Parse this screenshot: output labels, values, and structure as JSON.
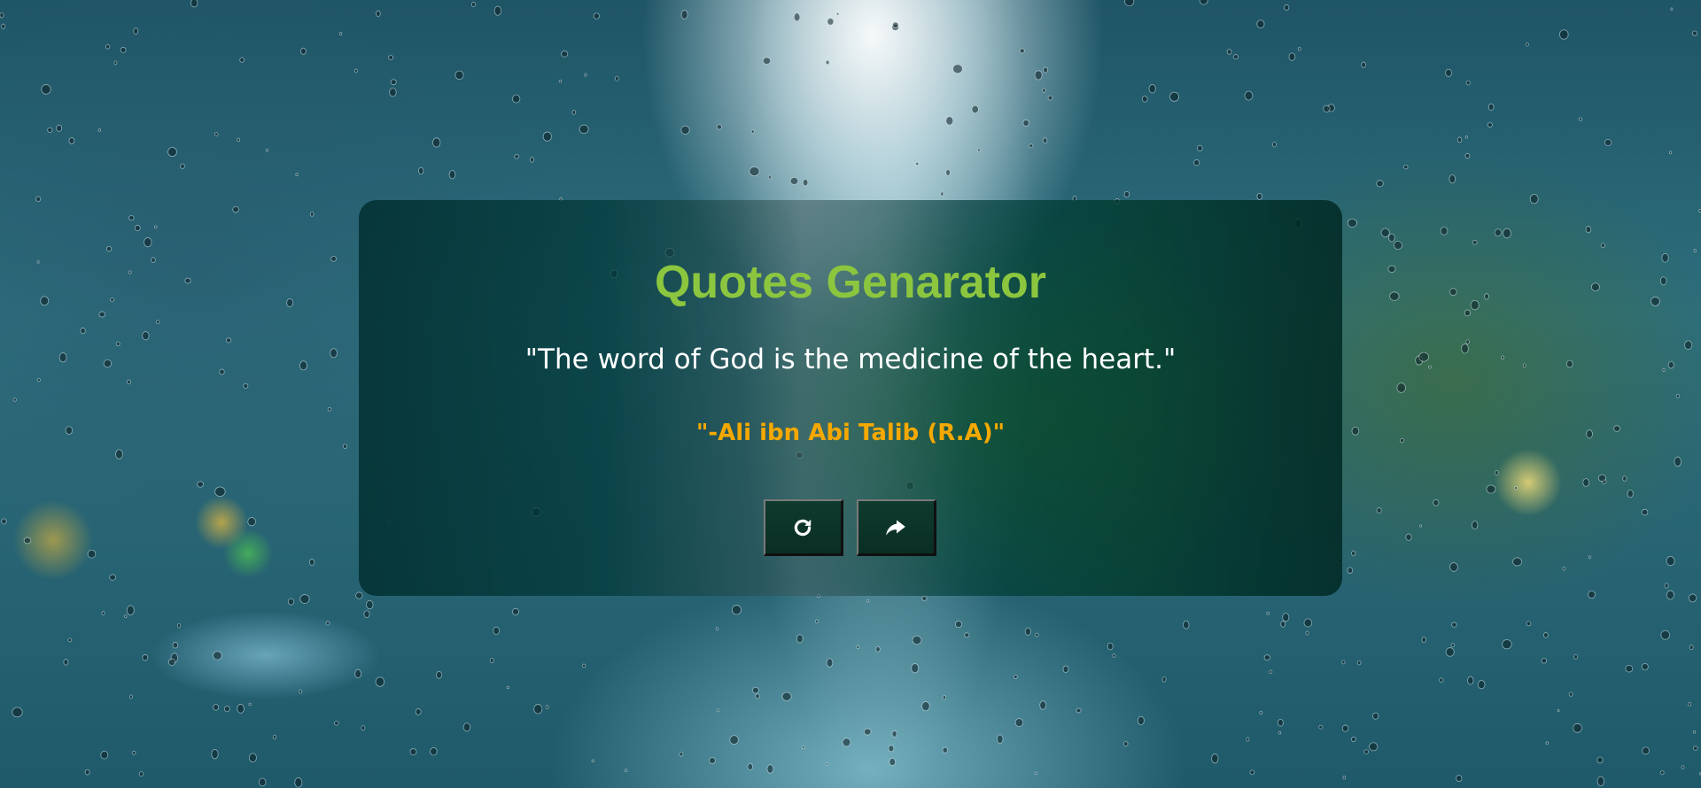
{
  "app": {
    "title": "Quotes Genarator"
  },
  "quote": {
    "text": "\"The word of God is the medicine of the heart.\"",
    "author": "\"-Ali ibn Abi Talib (R.A)\""
  },
  "buttons": {
    "new_quote_icon": "refresh-icon",
    "share_icon": "share-arrow-icon"
  },
  "colors": {
    "title": "#8cc63f",
    "quote_text": "#ffffff",
    "author": "#f5a800",
    "card_background": "#004040"
  }
}
